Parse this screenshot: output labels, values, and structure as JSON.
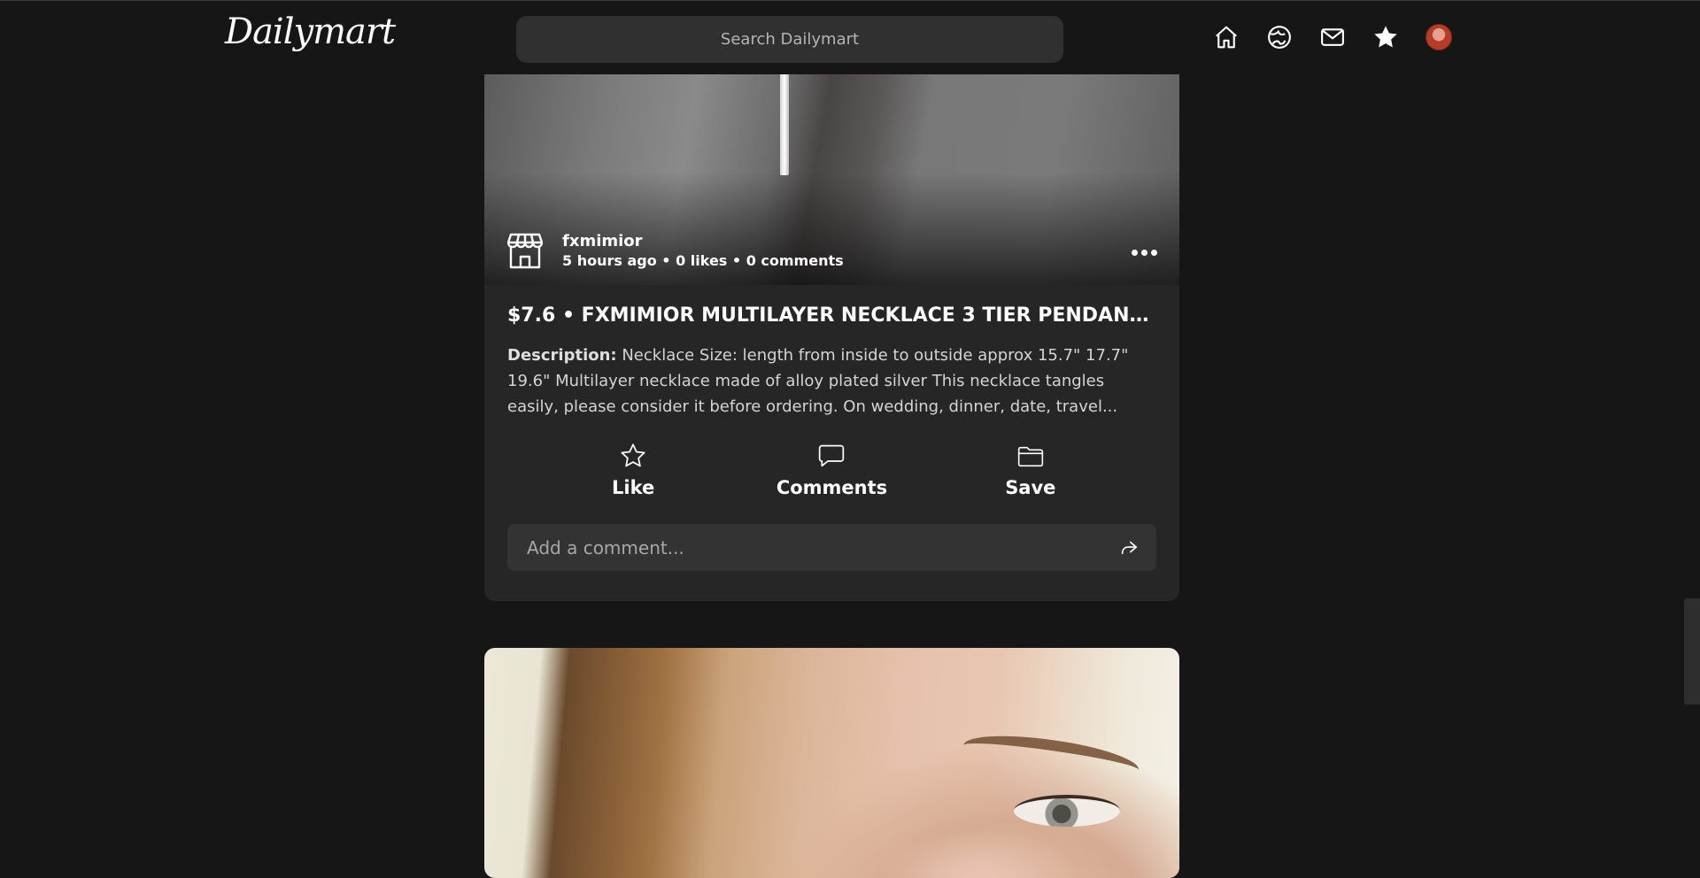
{
  "header": {
    "logo": "Dailymart",
    "search_placeholder": "Search Dailymart",
    "nav": [
      {
        "icon": "home-icon"
      },
      {
        "icon": "globe-icon"
      },
      {
        "icon": "mail-icon"
      },
      {
        "icon": "star-icon"
      },
      {
        "icon": "avatar"
      }
    ]
  },
  "post": {
    "seller_name": "fxmimior",
    "meta": "5 hours ago • 0 likes • 0 comments",
    "title": "$7.6 • FXMIMIOR MULTILAYER NECKLACE 3 TIER PENDANT...",
    "description_label": "Description:",
    "description_text": " Necklace Size: length from inside to outside approx 15.7\" 17.7\" 19.6\" Multilayer necklace made of alloy plated silver This necklace tangles easily, please consider it before ordering. On wedding, dinner, date, travel...",
    "actions": {
      "like": "Like",
      "comments": "Comments",
      "save": "Save"
    },
    "comment_placeholder": "Add a comment..."
  },
  "colors": {
    "background": "#161616",
    "card": "#262626",
    "input": "#333333"
  }
}
